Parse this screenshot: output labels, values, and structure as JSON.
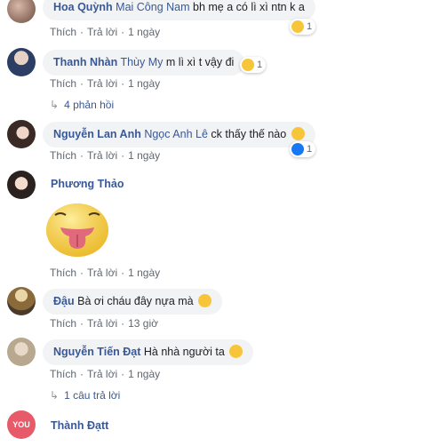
{
  "comments": [
    {
      "name": "Hoa Quỳnh",
      "tag": "Mai Công Nam",
      "text": "bh mẹ a có lì xì ntn k a",
      "actions": [
        "Thích",
        "Trả lời",
        "1 ngày"
      ],
      "reaction_count": "1"
    },
    {
      "name": "Thanh Nhàn",
      "tag": "Thùy My",
      "text": "m lì xì t vậy đi",
      "actions": [
        "Thích",
        "Trả lời",
        "1 ngày"
      ],
      "reaction_count": "1",
      "replies": "4 phản hồi"
    },
    {
      "name": "Nguyễn Lan Anh",
      "tag": "Ngọc Anh Lê",
      "text": "ck thấy thế nào",
      "actions": [
        "Thích",
        "Trả lời",
        "1 ngày"
      ],
      "reaction_count": "1"
    },
    {
      "name": "Phương Thảo",
      "actions": [
        "Thích",
        "Trả lời",
        "1 ngày"
      ]
    },
    {
      "name": "Đậu",
      "text": "Bà ơi cháu đây nựa mà",
      "actions": [
        "Thích",
        "Trả lời",
        "13 giờ"
      ]
    },
    {
      "name": "Nguyễn Tiến Đạt",
      "text": "Hà nhà người ta",
      "actions": [
        "Thích",
        "Trả lời",
        "1 ngày"
      ],
      "replies": "1 câu trả lời"
    },
    {
      "name": "Thành Đạtt",
      "avatar_text": "YOU"
    }
  ],
  "colors": {
    "link": "#385898",
    "meta": "#606770",
    "bubble": "#f2f3f5",
    "like": "#1877f2",
    "emoji": "#f7c53a"
  }
}
